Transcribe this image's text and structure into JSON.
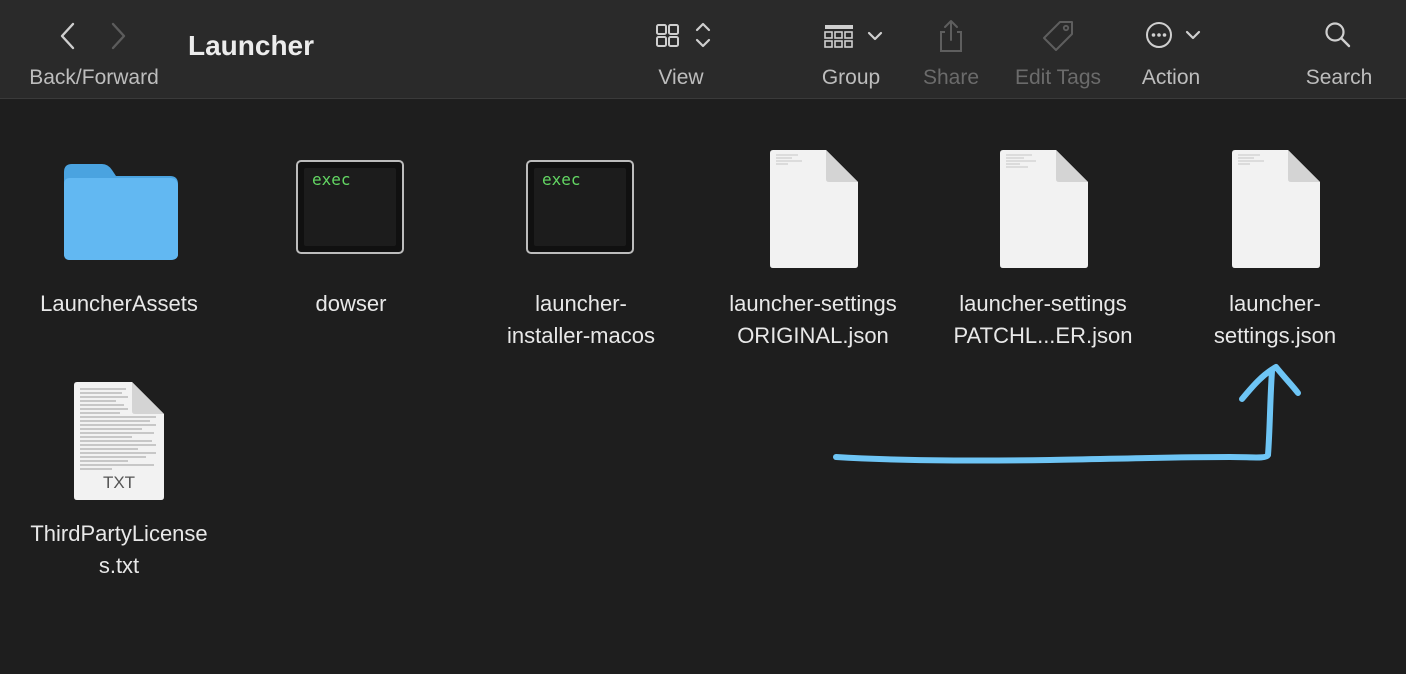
{
  "window": {
    "title": "Launcher"
  },
  "toolbar": {
    "back_forward_label": "Back/Forward",
    "view_label": "View",
    "group_label": "Group",
    "share_label": "Share",
    "edit_tags_label": "Edit Tags",
    "action_label": "Action",
    "search_label": "Search",
    "icons": {
      "back": "chevron-left-icon",
      "forward": "chevron-right-icon",
      "view": "grid-view-icon",
      "group": "group-icon",
      "share": "share-icon",
      "edit_tags": "tag-icon",
      "action": "ellipsis-circle-icon",
      "search": "search-icon"
    }
  },
  "files": [
    {
      "line1": "LauncherAssets",
      "line2": "",
      "kind": "folder"
    },
    {
      "line1": "dowser",
      "line2": "",
      "kind": "exec",
      "badge": "exec"
    },
    {
      "line1": "launcher-",
      "line2": "installer-macos",
      "kind": "exec",
      "badge": "exec"
    },
    {
      "line1": "launcher-settings",
      "line2": "ORIGINAL.json",
      "kind": "document"
    },
    {
      "line1": "launcher-settings",
      "line2": "PATCHL...ER.json",
      "kind": "document"
    },
    {
      "line1": "launcher-",
      "line2": "settings.json",
      "kind": "document"
    },
    {
      "line1": "ThirdPartyLicense",
      "line2": "s.txt",
      "kind": "text-document",
      "badge": "TXT"
    }
  ],
  "colors": {
    "toolbar_bg": "#2a2a2a",
    "content_bg": "#1e1e1e",
    "folder": "#5eb6f0",
    "annotation_arrow": "#6ec5f5",
    "exec_text": "#63d663"
  }
}
